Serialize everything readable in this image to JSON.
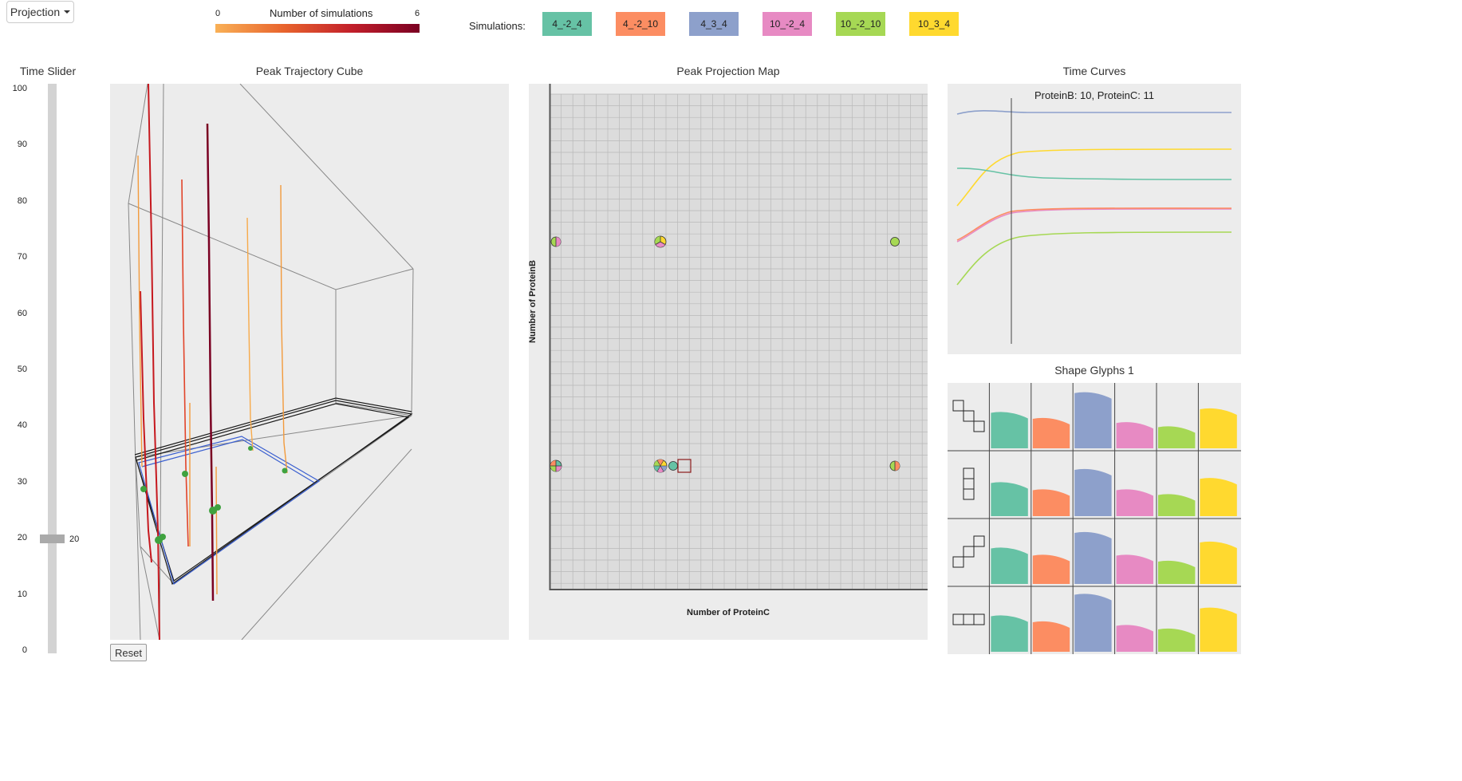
{
  "toolbar": {
    "projection_label": "Projection"
  },
  "legend": {
    "min": "0",
    "title": "Number of simulations",
    "max": "6"
  },
  "simulations": {
    "label": "Simulations:",
    "items": [
      {
        "label": "4_-2_4",
        "color": "#66c2a5"
      },
      {
        "label": "4_-2_10",
        "color": "#fc8d62"
      },
      {
        "label": "4_3_4",
        "color": "#8da0cb"
      },
      {
        "label": "10_-2_4",
        "color": "#e78ac3"
      },
      {
        "label": "10_-2_10",
        "color": "#a6d854"
      },
      {
        "label": "10_3_4",
        "color": "#ffd92f"
      }
    ]
  },
  "time_slider": {
    "title": "Time Slider",
    "value": "20",
    "ticks": [
      "100",
      "90",
      "80",
      "70",
      "60",
      "50",
      "40",
      "30",
      "20",
      "10",
      "0"
    ]
  },
  "cube": {
    "title": "Peak Trajectory Cube",
    "reset_label": "Reset"
  },
  "projection_map": {
    "title": "Peak Projection Map",
    "xlabel": "Number of ProteinC",
    "ylabel": "Number of ProteinB"
  },
  "time_curves": {
    "title": "Time Curves",
    "subtitle": "ProteinB: 10, ProteinC: 11"
  },
  "glyphs": {
    "title": "Shape Glyphs 1",
    "rows": [
      {
        "shape": "staircase-down-icon",
        "heights": [
          0.62,
          0.52,
          0.95,
          0.45,
          0.38,
          0.68
        ]
      },
      {
        "shape": "vertical-bar-icon",
        "heights": [
          0.58,
          0.46,
          0.8,
          0.46,
          0.38,
          0.65
        ]
      },
      {
        "shape": "staircase-up-icon",
        "heights": [
          0.62,
          0.5,
          0.88,
          0.5,
          0.4,
          0.72
        ]
      },
      {
        "shape": "horizontal-bar-icon",
        "heights": [
          0.62,
          0.52,
          0.98,
          0.46,
          0.4,
          0.75
        ]
      }
    ]
  }
}
